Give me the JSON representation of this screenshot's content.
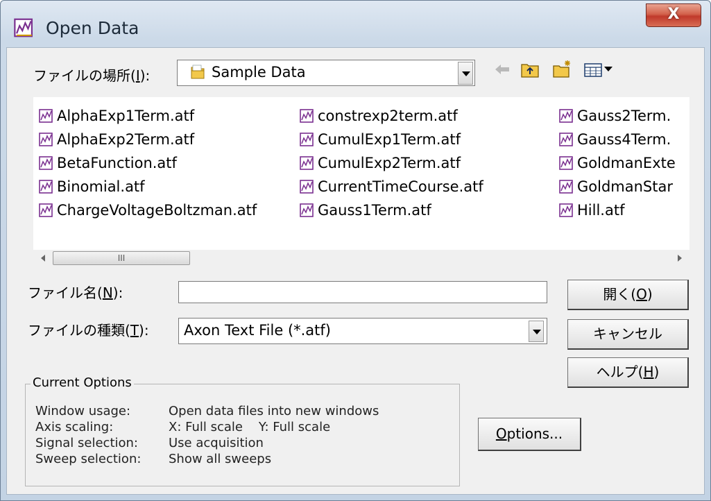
{
  "window": {
    "title": "Open Data",
    "close_label": "X"
  },
  "look_in": {
    "label": "ファイルの場所(I):",
    "label_pre": "ファイルの場所(",
    "label_key": "I",
    "label_post": "):",
    "value": "Sample Data"
  },
  "files": [
    [
      "AlphaExp1Term.atf",
      "AlphaExp2Term.atf",
      "BetaFunction.atf",
      "Binomial.atf",
      "ChargeVoltageBoltzman.atf"
    ],
    [
      "constrexp2term.atf",
      "CumulExp1Term.atf",
      "CumulExp2Term.atf",
      "CurrentTimeCourse.atf",
      "Gauss1Term.atf"
    ],
    [
      "Gauss2Term.",
      "Gauss4Term.",
      "GoldmanExte",
      "GoldmanStar",
      "Hill.atf"
    ]
  ],
  "filename": {
    "label_pre": "ファイル名(",
    "label_key": "N",
    "label_post": "):",
    "value": ""
  },
  "filetype": {
    "label_pre": "ファイルの種類(",
    "label_key": "T",
    "label_post": "):",
    "value": "Axon Text File (*.atf)"
  },
  "buttons": {
    "open_pre": "開く(",
    "open_key": "O",
    "open_post": ")",
    "cancel": "キャンセル",
    "help_pre": "ヘルプ(",
    "help_key": "H",
    "help_post": ")",
    "options_key": "O",
    "options_rest": "ptions..."
  },
  "current_options": {
    "title": "Current Options",
    "rows": [
      {
        "label": "Window usage:",
        "value": "Open data files into new windows"
      },
      {
        "label": "Axis scaling:",
        "value": "X: Full scale    Y: Full scale"
      },
      {
        "label": "Signal selection:",
        "value": "Use acquisition"
      },
      {
        "label": "Sweep selection:",
        "value": "Show all sweeps"
      }
    ]
  },
  "scrollbar": {
    "thumb_glyph": "III"
  },
  "colors": {
    "close_red": "#c0392b",
    "folder_yellow": "#e8b830",
    "icon_purple": "#7a2f8f"
  }
}
